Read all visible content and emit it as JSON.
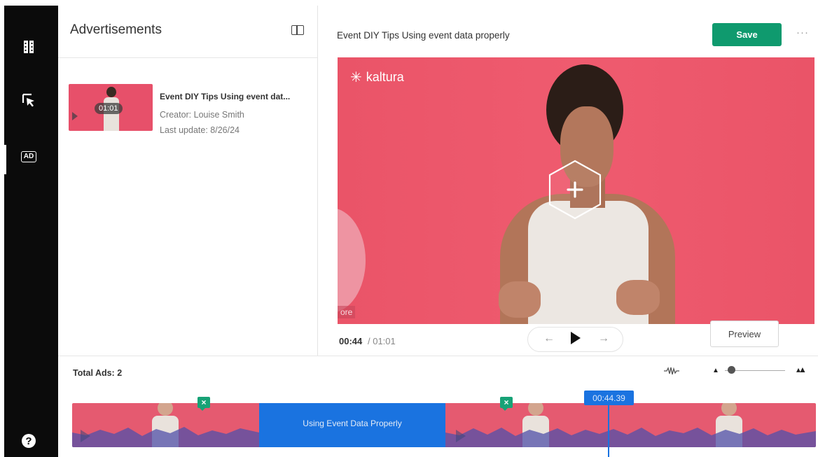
{
  "rail": {
    "items": [
      {
        "icon": "film-strip-icon"
      },
      {
        "icon": "cursor-pointer-icon"
      },
      {
        "icon": "ad-icon",
        "label": "AD"
      },
      {
        "icon": "help-icon",
        "label": "?"
      }
    ]
  },
  "panel": {
    "title": "Advertisements",
    "entry": {
      "duration": "01:01",
      "title": "Event DIY Tips Using event dat...",
      "creator": "Creator: Louise Smith",
      "updated": "Last update: 8/26/24"
    }
  },
  "header": {
    "video_title": "Event DIY Tips Using event data properly",
    "save_label": "Save",
    "more_label": "···"
  },
  "player": {
    "logo_text": "kaltura",
    "bg_label": "ore",
    "current_time": "00:44",
    "total_time": "/ 01:01",
    "preview_label": "Preview"
  },
  "timeline": {
    "total_ads_label": "Total Ads: 2",
    "ad_block_label": "Using Event Data Properly",
    "playhead_time": "00:44.39"
  },
  "colors": {
    "save": "#0f9a6e",
    "timeline_accent": "#1a73e0",
    "video_bg": "#ea5468",
    "rail_bg": "#0b0b0b"
  }
}
